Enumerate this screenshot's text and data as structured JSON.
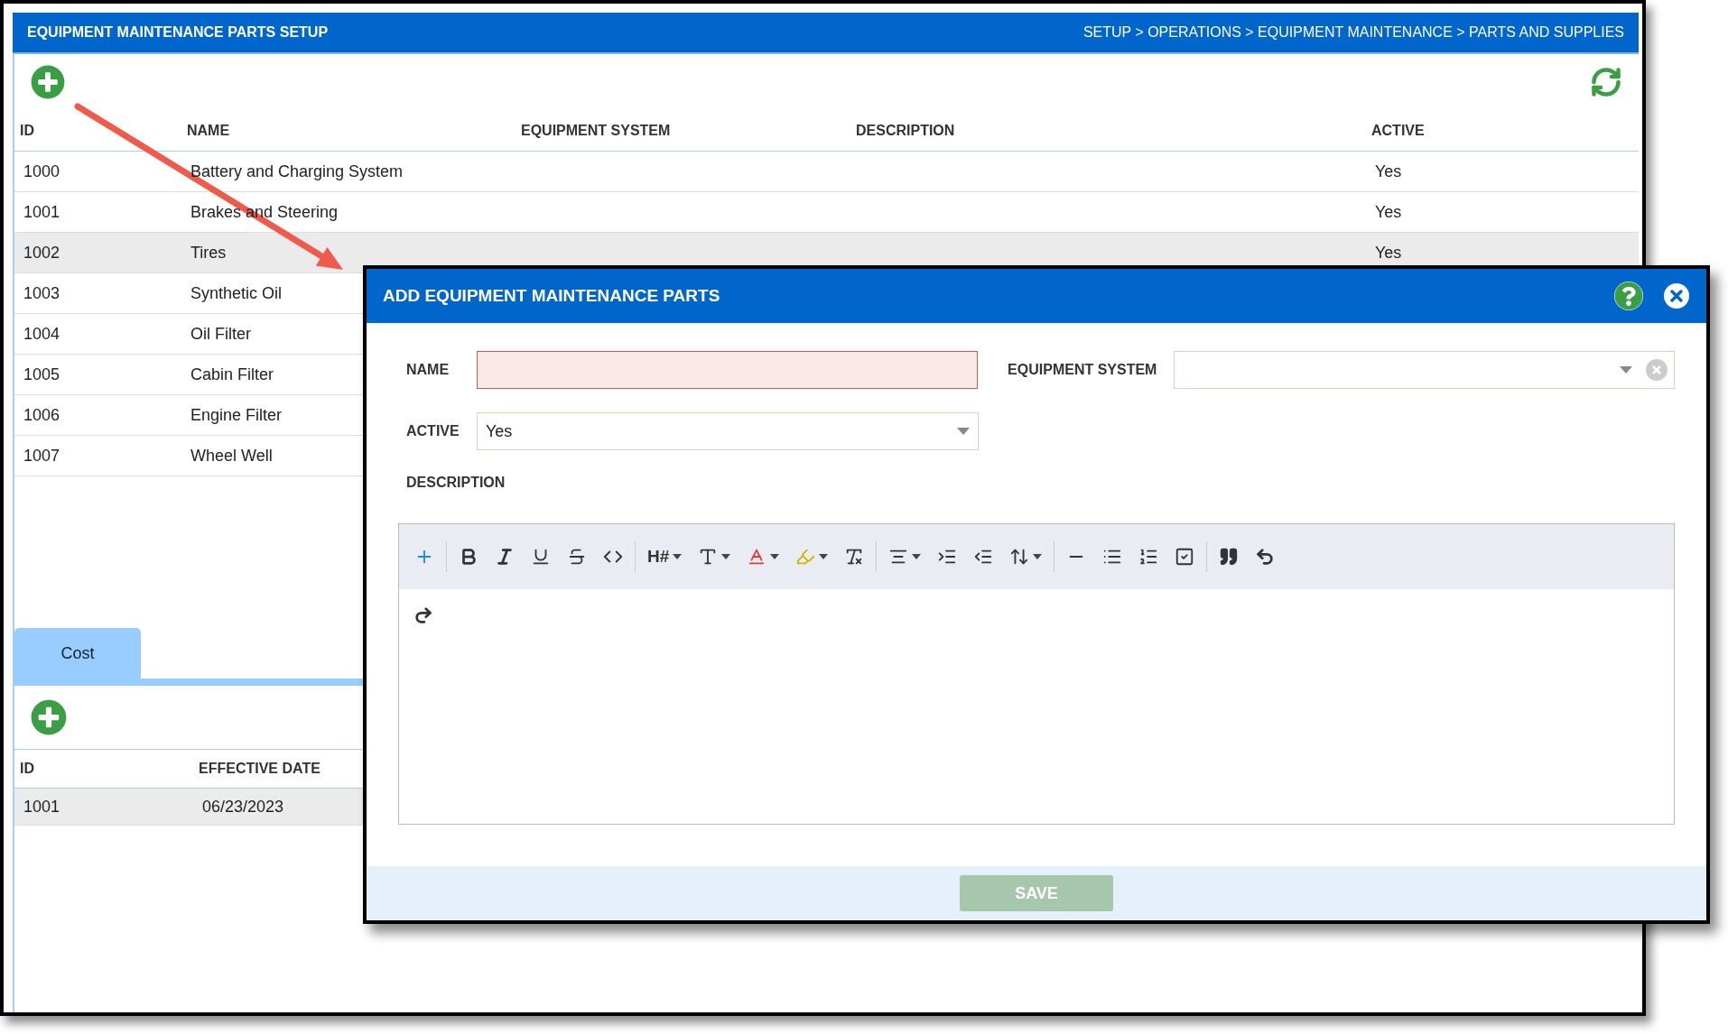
{
  "page": {
    "title": "EQUIPMENT MAINTENANCE PARTS SETUP",
    "breadcrumb": "SETUP > OPERATIONS > EQUIPMENT MAINTENANCE > PARTS AND SUPPLIES"
  },
  "table": {
    "columns": [
      "ID",
      "NAME",
      "EQUIPMENT SYSTEM",
      "DESCRIPTION",
      "ACTIVE"
    ],
    "rows": [
      {
        "id": "1000",
        "name": "Battery and Charging System",
        "active": "Yes",
        "selected": false
      },
      {
        "id": "1001",
        "name": "Brakes and Steering",
        "active": "Yes",
        "selected": false
      },
      {
        "id": "1002",
        "name": "Tires",
        "active": "Yes",
        "selected": true
      },
      {
        "id": "1003",
        "name": "Synthetic Oil",
        "selected": false
      },
      {
        "id": "1004",
        "name": "Oil Filter",
        "selected": false
      },
      {
        "id": "1005",
        "name": "Cabin Filter",
        "selected": false
      },
      {
        "id": "1006",
        "name": "Engine Filter",
        "selected": false
      },
      {
        "id": "1007",
        "name": "Wheel Well",
        "selected": false
      }
    ]
  },
  "tabs": [
    {
      "label": "Cost",
      "selected": true
    }
  ],
  "cost_table": {
    "columns": [
      "ID",
      "EFFECTIVE DATE"
    ],
    "rows": [
      {
        "id": "1001",
        "effective_date": "06/23/2023",
        "selected": true
      }
    ]
  },
  "dialog": {
    "title": "ADD EQUIPMENT MAINTENANCE PARTS",
    "name_field": {
      "label": "NAME",
      "invalid": true
    },
    "equipment_system_field": {
      "label": "EQUIPMENT SYSTEM"
    },
    "active_field": {
      "label": "ACTIVE",
      "value": "Yes"
    },
    "description_label": "DESCRIPTION",
    "heading_button_label": "H#",
    "save_button": {
      "label": "SAVE",
      "disabled": true
    }
  }
}
